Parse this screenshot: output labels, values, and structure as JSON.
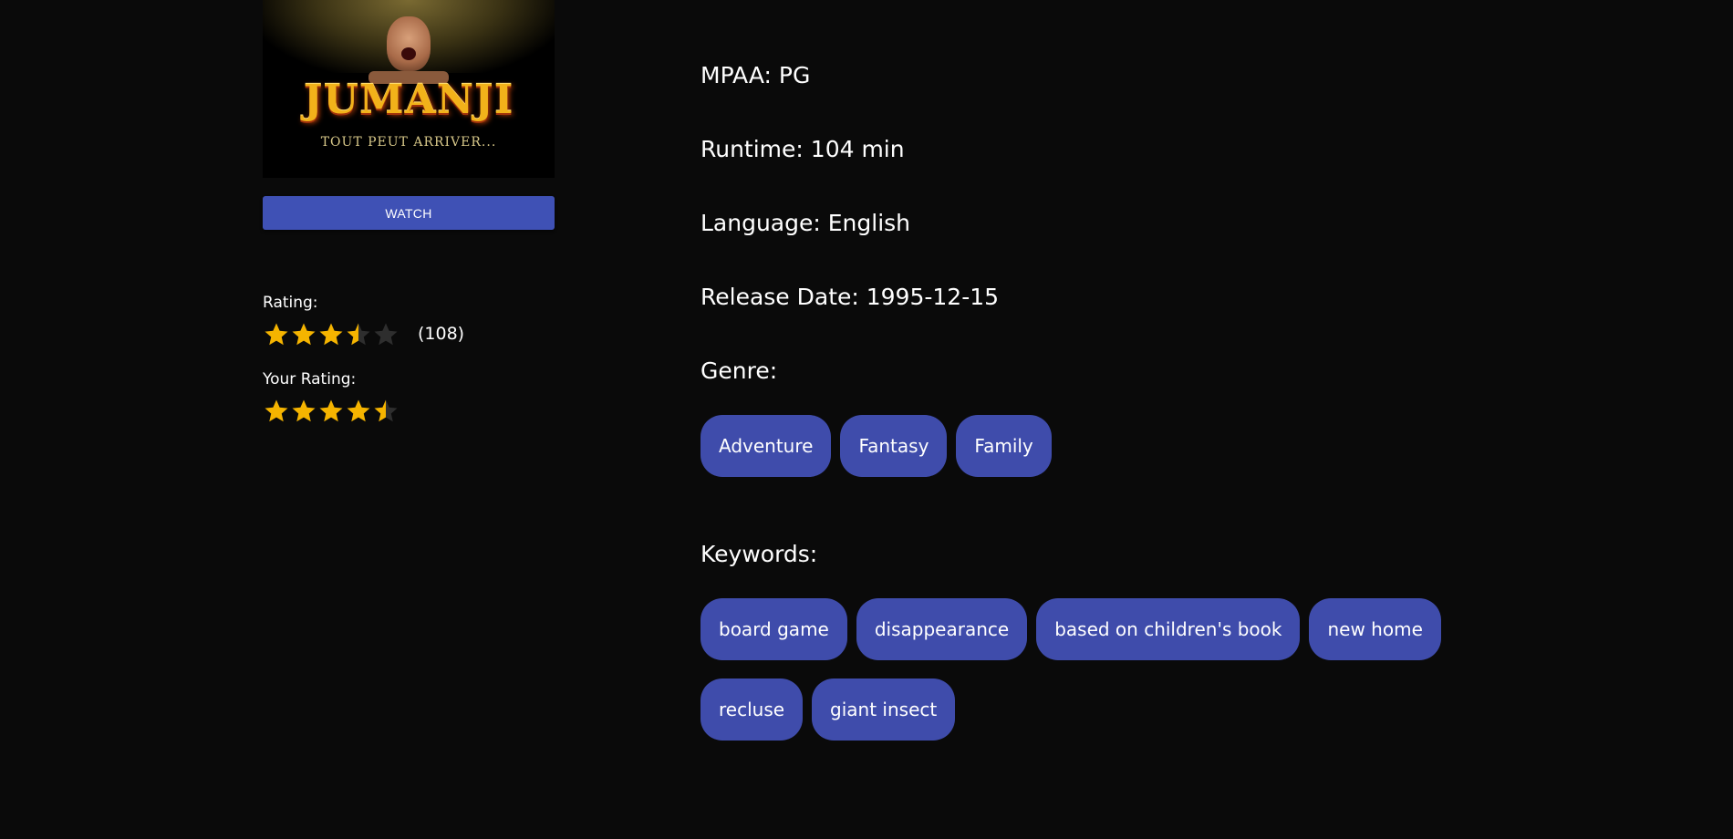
{
  "poster": {
    "title": "JUMANJI",
    "tagline": "TOUT PEUT ARRIVER..."
  },
  "actions": {
    "watch_label": "WATCH"
  },
  "rating": {
    "label": "Rating:",
    "value": 3.5,
    "max": 5,
    "count": "(108)"
  },
  "your_rating": {
    "label": "Your Rating:",
    "value": 4.5,
    "max": 5
  },
  "details": {
    "mpaa": "MPAA: PG",
    "runtime": "Runtime: 104 min",
    "language": "Language: English",
    "release_date": "Release Date: 1995-12-15"
  },
  "genre": {
    "label": "Genre:",
    "items": [
      "Adventure",
      "Fantasy",
      "Family"
    ]
  },
  "keywords": {
    "label": "Keywords:",
    "items": [
      "board game",
      "disappearance",
      "based on children's book",
      "new home",
      "recluse",
      "giant insect"
    ]
  },
  "colors": {
    "background": "#0a0a0a",
    "accent": "#3f51b5",
    "chip": "#3f4cab",
    "star_filled": "#f5b400",
    "star_empty": "#2e2e2e"
  }
}
